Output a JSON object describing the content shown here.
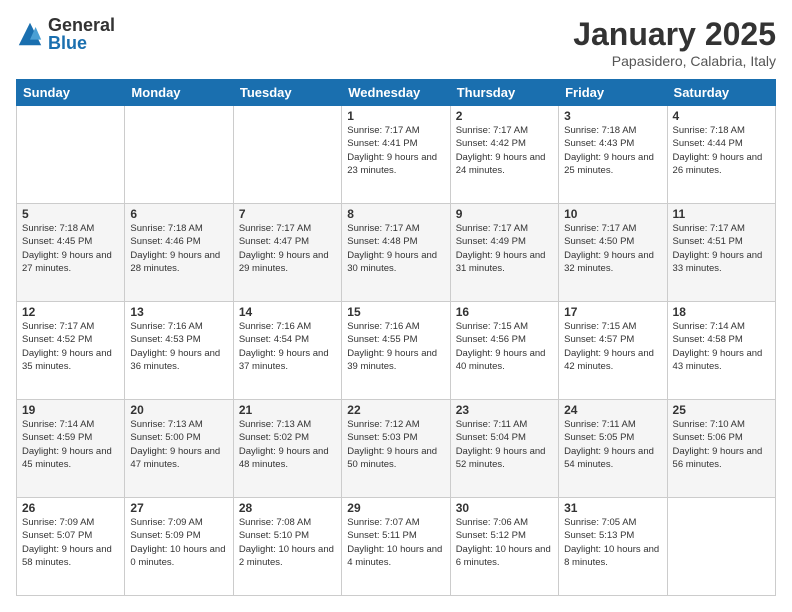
{
  "header": {
    "logo": {
      "general": "General",
      "blue": "Blue"
    },
    "title": "January 2025",
    "location": "Papasidero, Calabria, Italy"
  },
  "weekdays": [
    "Sunday",
    "Monday",
    "Tuesday",
    "Wednesday",
    "Thursday",
    "Friday",
    "Saturday"
  ],
  "weeks": [
    [
      null,
      null,
      null,
      {
        "day": 1,
        "sunrise": "7:17 AM",
        "sunset": "4:41 PM",
        "daylight": "9 hours and 23 minutes."
      },
      {
        "day": 2,
        "sunrise": "7:17 AM",
        "sunset": "4:42 PM",
        "daylight": "9 hours and 24 minutes."
      },
      {
        "day": 3,
        "sunrise": "7:18 AM",
        "sunset": "4:43 PM",
        "daylight": "9 hours and 25 minutes."
      },
      {
        "day": 4,
        "sunrise": "7:18 AM",
        "sunset": "4:44 PM",
        "daylight": "9 hours and 26 minutes."
      }
    ],
    [
      {
        "day": 5,
        "sunrise": "7:18 AM",
        "sunset": "4:45 PM",
        "daylight": "9 hours and 27 minutes."
      },
      {
        "day": 6,
        "sunrise": "7:18 AM",
        "sunset": "4:46 PM",
        "daylight": "9 hours and 28 minutes."
      },
      {
        "day": 7,
        "sunrise": "7:17 AM",
        "sunset": "4:47 PM",
        "daylight": "9 hours and 29 minutes."
      },
      {
        "day": 8,
        "sunrise": "7:17 AM",
        "sunset": "4:48 PM",
        "daylight": "9 hours and 30 minutes."
      },
      {
        "day": 9,
        "sunrise": "7:17 AM",
        "sunset": "4:49 PM",
        "daylight": "9 hours and 31 minutes."
      },
      {
        "day": 10,
        "sunrise": "7:17 AM",
        "sunset": "4:50 PM",
        "daylight": "9 hours and 32 minutes."
      },
      {
        "day": 11,
        "sunrise": "7:17 AM",
        "sunset": "4:51 PM",
        "daylight": "9 hours and 33 minutes."
      }
    ],
    [
      {
        "day": 12,
        "sunrise": "7:17 AM",
        "sunset": "4:52 PM",
        "daylight": "9 hours and 35 minutes."
      },
      {
        "day": 13,
        "sunrise": "7:16 AM",
        "sunset": "4:53 PM",
        "daylight": "9 hours and 36 minutes."
      },
      {
        "day": 14,
        "sunrise": "7:16 AM",
        "sunset": "4:54 PM",
        "daylight": "9 hours and 37 minutes."
      },
      {
        "day": 15,
        "sunrise": "7:16 AM",
        "sunset": "4:55 PM",
        "daylight": "9 hours and 39 minutes."
      },
      {
        "day": 16,
        "sunrise": "7:15 AM",
        "sunset": "4:56 PM",
        "daylight": "9 hours and 40 minutes."
      },
      {
        "day": 17,
        "sunrise": "7:15 AM",
        "sunset": "4:57 PM",
        "daylight": "9 hours and 42 minutes."
      },
      {
        "day": 18,
        "sunrise": "7:14 AM",
        "sunset": "4:58 PM",
        "daylight": "9 hours and 43 minutes."
      }
    ],
    [
      {
        "day": 19,
        "sunrise": "7:14 AM",
        "sunset": "4:59 PM",
        "daylight": "9 hours and 45 minutes."
      },
      {
        "day": 20,
        "sunrise": "7:13 AM",
        "sunset": "5:00 PM",
        "daylight": "9 hours and 47 minutes."
      },
      {
        "day": 21,
        "sunrise": "7:13 AM",
        "sunset": "5:02 PM",
        "daylight": "9 hours and 48 minutes."
      },
      {
        "day": 22,
        "sunrise": "7:12 AM",
        "sunset": "5:03 PM",
        "daylight": "9 hours and 50 minutes."
      },
      {
        "day": 23,
        "sunrise": "7:11 AM",
        "sunset": "5:04 PM",
        "daylight": "9 hours and 52 minutes."
      },
      {
        "day": 24,
        "sunrise": "7:11 AM",
        "sunset": "5:05 PM",
        "daylight": "9 hours and 54 minutes."
      },
      {
        "day": 25,
        "sunrise": "7:10 AM",
        "sunset": "5:06 PM",
        "daylight": "9 hours and 56 minutes."
      }
    ],
    [
      {
        "day": 26,
        "sunrise": "7:09 AM",
        "sunset": "5:07 PM",
        "daylight": "9 hours and 58 minutes."
      },
      {
        "day": 27,
        "sunrise": "7:09 AM",
        "sunset": "5:09 PM",
        "daylight": "10 hours and 0 minutes."
      },
      {
        "day": 28,
        "sunrise": "7:08 AM",
        "sunset": "5:10 PM",
        "daylight": "10 hours and 2 minutes."
      },
      {
        "day": 29,
        "sunrise": "7:07 AM",
        "sunset": "5:11 PM",
        "daylight": "10 hours and 4 minutes."
      },
      {
        "day": 30,
        "sunrise": "7:06 AM",
        "sunset": "5:12 PM",
        "daylight": "10 hours and 6 minutes."
      },
      {
        "day": 31,
        "sunrise": "7:05 AM",
        "sunset": "5:13 PM",
        "daylight": "10 hours and 8 minutes."
      },
      null
    ]
  ]
}
